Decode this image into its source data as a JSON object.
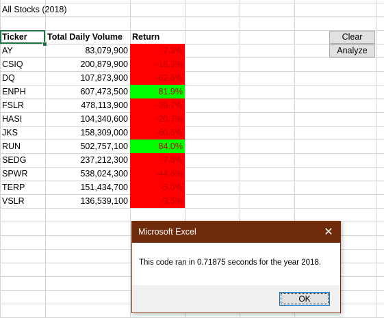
{
  "sheet": {
    "title": "All Stocks (2018)",
    "headers": {
      "ticker": "Ticker",
      "volume": "Total Daily Volume",
      "return": "Return"
    },
    "rows": [
      {
        "ticker": "AY",
        "volume": "83,079,900",
        "return": "-7.3%",
        "positive": false
      },
      {
        "ticker": "CSIQ",
        "volume": "200,879,900",
        "return": "-16.3%",
        "positive": false
      },
      {
        "ticker": "DQ",
        "volume": "107,873,900",
        "return": "-62.6%",
        "positive": false
      },
      {
        "ticker": "ENPH",
        "volume": "607,473,500",
        "return": "81.9%",
        "positive": true
      },
      {
        "ticker": "FSLR",
        "volume": "478,113,900",
        "return": "-39.7%",
        "positive": false
      },
      {
        "ticker": "HASI",
        "volume": "104,340,600",
        "return": "-20.7%",
        "positive": false
      },
      {
        "ticker": "JKS",
        "volume": "158,309,000",
        "return": "-60.5%",
        "positive": false
      },
      {
        "ticker": "RUN",
        "volume": "502,757,100",
        "return": "84.0%",
        "positive": true
      },
      {
        "ticker": "SEDG",
        "volume": "237,212,300",
        "return": "-7.8%",
        "positive": false
      },
      {
        "ticker": "SPWR",
        "volume": "538,024,300",
        "return": "-44.6%",
        "positive": false
      },
      {
        "ticker": "TERP",
        "volume": "151,434,700",
        "return": "-5.0%",
        "positive": false
      },
      {
        "ticker": "VSLR",
        "volume": "136,539,100",
        "return": "-3.5%",
        "positive": false
      }
    ]
  },
  "buttons": {
    "clear": "Clear",
    "analyze": "Analyze"
  },
  "dialog": {
    "title": "Microsoft Excel",
    "close_icon": "close-icon",
    "message": "This code ran in 0.71875 seconds for the year 2018.",
    "ok_label": "OK"
  },
  "colors": {
    "negative_fill": "#ff0000",
    "positive_fill": "#00ff00",
    "return_text": "#c00000",
    "dialog_titlebar": "#6f2b0c",
    "selection": "#217346"
  }
}
